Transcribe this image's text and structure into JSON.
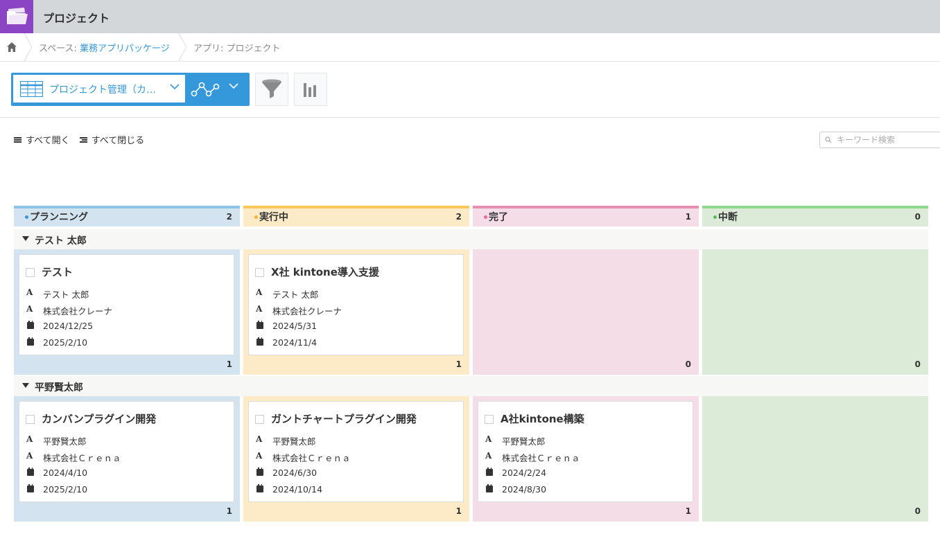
{
  "app": {
    "title": "プロジェクト"
  },
  "breadcrumb": {
    "space_prefix": "スペース: ",
    "space_name": "業務アプリパッケージ",
    "app_label": "アプリ: プロジェクト"
  },
  "toolbar": {
    "view_name": "プロジェクト管理（カ…"
  },
  "controls": {
    "expand_all": "すべて開く",
    "collapse_all": "すべて閉じる",
    "search_placeholder": "キーワード検索"
  },
  "colors": {
    "planning": {
      "bar": "#8ec3ea",
      "bg": "#d3e4f0",
      "dot": "#3498db"
    },
    "inprogress": {
      "bar": "#ffc65a",
      "bg": "#fdebc7",
      "dot": "#f5b335"
    },
    "done": {
      "bar": "#ea8eb2",
      "bg": "#f4dde6",
      "dot": "#e86aa0"
    },
    "stopped": {
      "bar": "#8dd88a",
      "bg": "#dcebd8",
      "dot": "#5cb85c"
    }
  },
  "columns": [
    {
      "name": "プランニング",
      "count": "2"
    },
    {
      "name": "実行中",
      "count": "2"
    },
    {
      "name": "完了",
      "count": "1"
    },
    {
      "name": "中断",
      "count": "0"
    }
  ],
  "groups": [
    {
      "name": "テスト 太郎",
      "cells": [
        {
          "count": "1",
          "card": {
            "title": "テスト",
            "person": "テスト 太郎",
            "company": "株式会社クレーナ",
            "start": "2024/12/25",
            "end": "2025/2/10"
          }
        },
        {
          "count": "1",
          "card": {
            "title": "X社 kintone導入支援",
            "person": "テスト 太郎",
            "company": "株式会社クレーナ",
            "start": "2024/5/31",
            "end": "2024/11/4"
          }
        },
        {
          "count": "0",
          "card": null
        },
        {
          "count": "0",
          "card": null
        }
      ]
    },
    {
      "name": "平野賢太郎",
      "cells": [
        {
          "count": "1",
          "card": {
            "title": "カンバンプラグイン開発",
            "person": "平野賢太郎",
            "company": "株式会社Ｃｒｅｎａ",
            "start": "2024/4/10",
            "end": "2025/2/10"
          }
        },
        {
          "count": "1",
          "card": {
            "title": "ガントチャートプラグイン開発",
            "person": "平野賢太郎",
            "company": "株式会社Ｃｒｅｎａ",
            "start": "2024/6/30",
            "end": "2024/10/14"
          }
        },
        {
          "count": "1",
          "card": {
            "title": "A社kintone構築",
            "person": "平野賢太郎",
            "company": "株式会社Ｃｒｅｎａ",
            "start": "2024/2/24",
            "end": "2024/8/30"
          }
        },
        {
          "count": "0",
          "card": null
        }
      ]
    }
  ]
}
